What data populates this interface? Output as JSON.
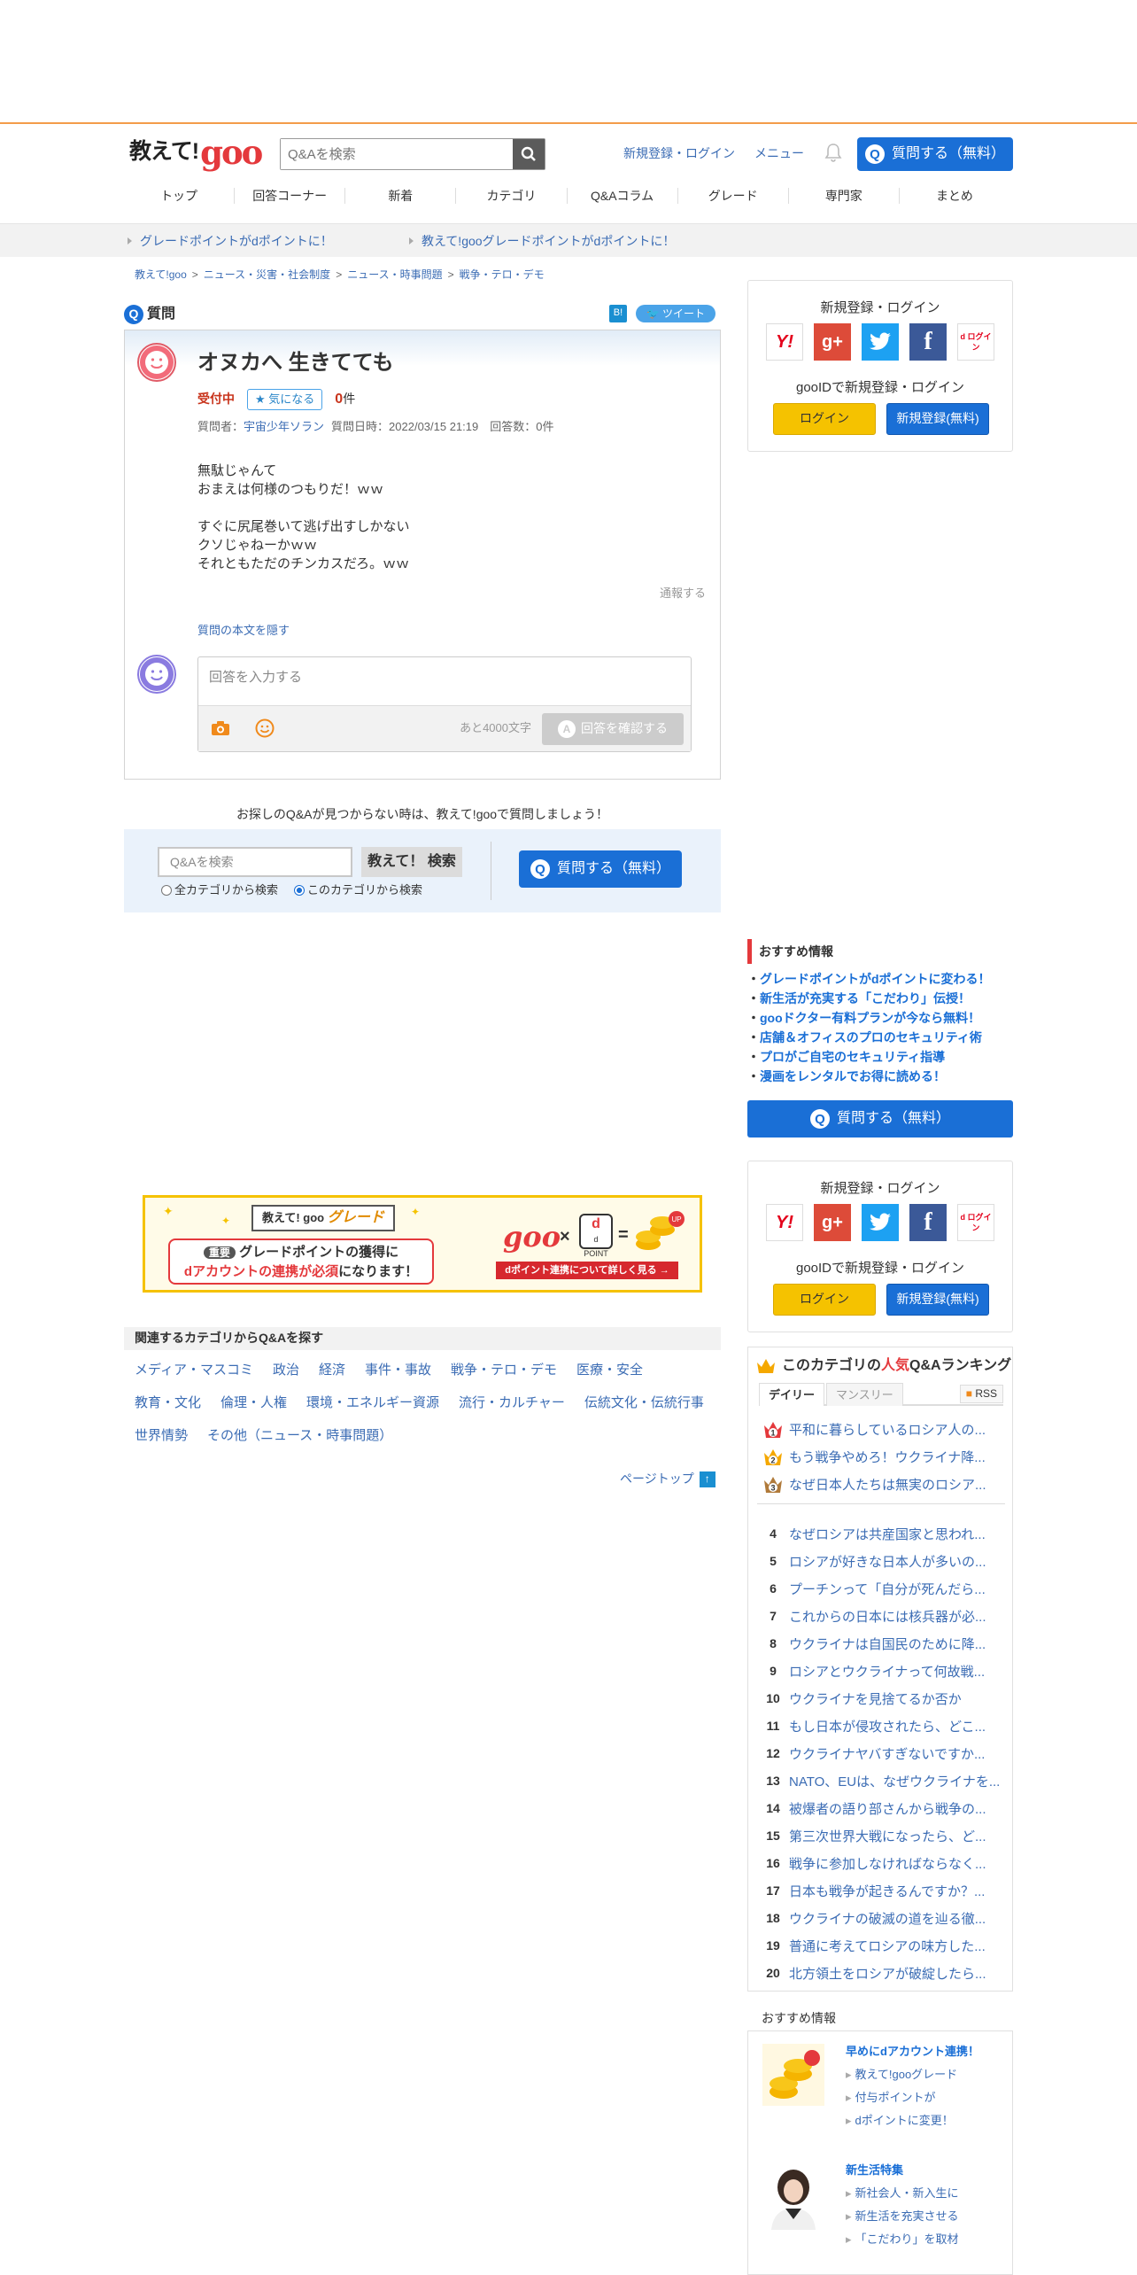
{
  "header": {
    "logo_a": "教えて!",
    "logo_b": "goo",
    "search_placeholder": "Q&Aを検索",
    "links": [
      "新規登録・ログイン",
      "メニュー"
    ],
    "ask_button": "質問する（無料）"
  },
  "nav": [
    "トップ",
    "回答コーナー",
    "新着",
    "カテゴリ",
    "Q&Aコラム",
    "グレード",
    "専門家",
    "まとめ"
  ],
  "notices": [
    "グレードポイントがdポイントに！",
    "教えて!gooグレードポイントがdポイントに！"
  ],
  "breadcrumb": [
    "教えて!goo",
    "ニュース・災害・社会制度",
    "ニュース・時事問題",
    "戦争・テロ・デモ"
  ],
  "question": {
    "section_label": "質問",
    "share_hatena": "B!",
    "share_tweet": "ツイート",
    "title": "オヌカへ 生きてても",
    "status": "受付中",
    "favorite": "気になる",
    "count": "0",
    "count_unit": "件",
    "meta_asker_label": "質問者：",
    "meta_asker": "宇宙少年ソラン",
    "meta_rest": "質問日時：2022/03/15 21:19　回答数：0件",
    "body_lines": [
      "無駄じゃんて",
      "おまえは何様のつもりだ！ｗｗ",
      "",
      "すぐに尻尾巻いて逃げ出すしかない",
      "クソじゃねーかｗｗ",
      "それともただのチンカスだろ。ｗｗ"
    ],
    "report": "通報する",
    "hide_body": "質問の本文を隠す",
    "answer_placeholder": "回答を入力する",
    "remaining": "あと4000文字",
    "confirm": "回答を確認する"
  },
  "find": {
    "text": "お探しのQ&Aが見つからない時は、教えて!gooで質問しましょう！",
    "placeholder": "Q&Aを検索",
    "search_button": "教えて！ 検索",
    "radio_all": "全カテゴリから検索",
    "radio_this": "このカテゴリから検索",
    "ask_button": "質問する（無料）"
  },
  "banner": {
    "badge": "教えて! goo",
    "title": "グレード",
    "important": "重要",
    "line1": "グレードポイントの獲得に",
    "line2_emph": "dアカウントの連携が必須",
    "line2_rest": "になります！",
    "goo": "goo",
    "dpoint": "d POINT",
    "up": "UP",
    "link": "dポイント連携について詳しく見る →"
  },
  "related": {
    "heading": "関連するカテゴリからQ&Aを探す",
    "cats": [
      "メディア・マスコミ",
      "政治",
      "経済",
      "事件・事故",
      "戦争・テロ・デモ",
      "医療・安全",
      "教育・文化",
      "倫理・人権",
      "環境・エネルギー資源",
      "流行・カルチャー",
      "伝統文化・伝統行事",
      "世界情勢",
      "その他（ニュース・時事問題）"
    ]
  },
  "pagetop": "ページトップ",
  "sidebar": {
    "login_title": "新規登録・ログイン",
    "gooid": "gooIDで新規登録・ログイン",
    "login_btn": "ログイン",
    "signup_btn": "新規登録(無料)",
    "social": [
      "Y!",
      "g+",
      "twitter",
      "f",
      "d ログイン"
    ],
    "reco_title": "おすすめ情報",
    "reco_items": [
      "グレードポイントがdポイントに変わる！",
      "新生活が充実する「こだわり」伝授！",
      "gooドクター有料プランが今なら無料！",
      "店舗＆オフィスのプロのセキュリティ術",
      "プロがご自宅のセキュリティ指導",
      "漫画をレンタルでお得に読める！"
    ],
    "ask_button": "質問する（無料）"
  },
  "ranking": {
    "title_pre": "このカテゴリの",
    "title_hl": "人気",
    "title_post": "Q&Aランキング",
    "tab_daily": "デイリー",
    "tab_monthly": "マンスリー",
    "rss": "RSS",
    "items": [
      {
        "n": "1",
        "t": "平和に暮らしているロシア人の..."
      },
      {
        "n": "2",
        "t": "もう戦争やめろ！ウクライナ降..."
      },
      {
        "n": "3",
        "t": "なぜ日本人たちは無実のロシア..."
      },
      {
        "n": "4",
        "t": "なぜロシアは共産国家と思われ..."
      },
      {
        "n": "5",
        "t": "ロシアが好きな日本人が多いの..."
      },
      {
        "n": "6",
        "t": "プーチンって「自分が死んだら..."
      },
      {
        "n": "7",
        "t": "これからの日本には核兵器が必..."
      },
      {
        "n": "8",
        "t": "ウクライナは自国民のために降..."
      },
      {
        "n": "9",
        "t": "ロシアとウクライナって何故戦..."
      },
      {
        "n": "10",
        "t": "ウクライナを見捨てるか否か"
      },
      {
        "n": "11",
        "t": "もし日本が侵攻されたら、どこ..."
      },
      {
        "n": "12",
        "t": "ウクライナヤバすぎないですか..."
      },
      {
        "n": "13",
        "t": "NATO、EUは、なぜウクライナを..."
      },
      {
        "n": "14",
        "t": "被爆者の語り部さんから戦争の..."
      },
      {
        "n": "15",
        "t": "第三次世界大戦になったら、ど..."
      },
      {
        "n": "16",
        "t": "戦争に参加しなければならなく..."
      },
      {
        "n": "17",
        "t": "日本も戦争が起きるんですか？..."
      },
      {
        "n": "18",
        "t": "ウクライナの破滅の道を辿る徹..."
      },
      {
        "n": "19",
        "t": "普通に考えてロシアの味方した..."
      },
      {
        "n": "20",
        "t": "北方領土をロシアが破綻したら..."
      }
    ]
  },
  "reco2": {
    "title": "おすすめ情報",
    "p1_title": "早めにdアカウント連携！",
    "p1_lines": [
      "教えて!gooグレード",
      "付与ポイントが",
      "dポイントに変更！"
    ],
    "p2_title": "新生活特集",
    "p2_lines": [
      "新社会人・新入生に",
      "新生活を充実させる",
      "「こだわり」を取材"
    ]
  },
  "colors": {
    "accent": "#1a6fd6",
    "brand_red": "#e4393c",
    "orange_line": "#f39c4a",
    "login_yellow": "#f5c200"
  }
}
